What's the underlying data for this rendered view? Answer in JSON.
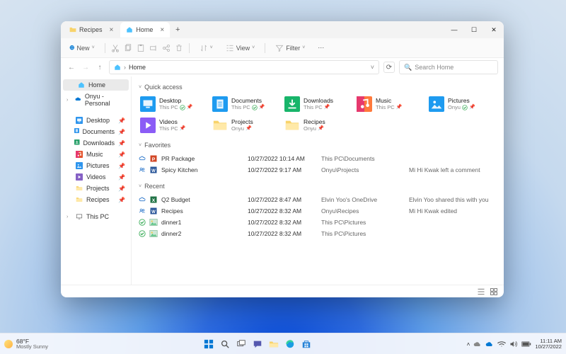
{
  "tabs": [
    {
      "label": "Recipes",
      "active": false,
      "icon_color": "#f8d36b"
    },
    {
      "label": "Home",
      "active": true,
      "icon_color": "#4cc2ff"
    }
  ],
  "toolbar": {
    "new": "New",
    "view": "View",
    "filter": "Filter"
  },
  "breadcrumb": {
    "location": "Home"
  },
  "search": {
    "placeholder": "Search Home"
  },
  "sidebar": {
    "top": [
      {
        "label": "Home",
        "icon": "home",
        "selected": true
      },
      {
        "label": "Onyu - Personal",
        "icon": "onedrive",
        "expandable": true
      }
    ],
    "pinned": [
      {
        "label": "Desktop",
        "icon": "desktop",
        "color": "#2f95ed"
      },
      {
        "label": "Documents",
        "icon": "documents",
        "color": "#2f95ed"
      },
      {
        "label": "Downloads",
        "icon": "downloads",
        "color": "#29a06a"
      },
      {
        "label": "Music",
        "icon": "music",
        "color": "#e5522c"
      },
      {
        "label": "Pictures",
        "icon": "pictures",
        "color": "#2f95ed"
      },
      {
        "label": "Videos",
        "icon": "videos",
        "color": "#8661c5"
      },
      {
        "label": "Projects",
        "icon": "folder",
        "color": "#f8d36b"
      },
      {
        "label": "Recipes",
        "icon": "folder",
        "color": "#f8d36b"
      }
    ],
    "thispc": {
      "label": "This PC"
    }
  },
  "sections": {
    "quick_access": {
      "title": "Quick access",
      "items": [
        {
          "name": "Desktop",
          "sub": "This PC",
          "color": "#1e9bf0",
          "icon": "desktop",
          "sync": "green"
        },
        {
          "name": "Documents",
          "sub": "This PC",
          "color": "#1e9bf0",
          "icon": "documents",
          "sync": "green"
        },
        {
          "name": "Downloads",
          "sub": "This PC",
          "color": "#18b56a",
          "icon": "downloads",
          "sync": ""
        },
        {
          "name": "Music",
          "sub": "This PC",
          "color": "#ff7a3c",
          "icon": "music",
          "sync": ""
        },
        {
          "name": "Pictures",
          "sub": "Onyu",
          "color": "#1e9bf0",
          "icon": "pictures",
          "sync": "green"
        },
        {
          "name": "Videos",
          "sub": "This PC",
          "color": "#8b5cf6",
          "icon": "videos",
          "sync": ""
        },
        {
          "name": "Projects",
          "sub": "Onyu",
          "color": "#f8d36b",
          "icon": "folder",
          "sync": ""
        },
        {
          "name": "Recipes",
          "sub": "Onyu",
          "color": "#f8d36b",
          "icon": "folder",
          "sync": ""
        }
      ]
    },
    "favorites": {
      "title": "Favorites",
      "items": [
        {
          "name": "PR Package",
          "date": "10/27/2022 10:14 AM",
          "path": "This PC\\Documents",
          "meta": "",
          "icon": "ppt",
          "icon_color": "#d24726",
          "sync": "cloud"
        },
        {
          "name": "Spicy Kitchen",
          "date": "10/27/2022 9:17 AM",
          "path": "Onyu\\Projects",
          "meta": "Mi Hi Kwak left a comment",
          "icon": "word",
          "icon_color": "#2b579a",
          "sync": "people"
        }
      ]
    },
    "recent": {
      "title": "Recent",
      "items": [
        {
          "name": "Q2 Budget",
          "date": "10/27/2022 8:47 AM",
          "path": "Elvin Yoo's OneDrive",
          "meta": "Elvin Yoo shared this with you",
          "icon": "xls",
          "icon_color": "#217346",
          "sync": "cloud"
        },
        {
          "name": "Recipes",
          "date": "10/27/2022 8:32 AM",
          "path": "Onyu\\Recipes",
          "meta": "Mi Hi Kwak edited",
          "icon": "word",
          "icon_color": "#2b579a",
          "sync": "people"
        },
        {
          "name": "dinner1",
          "date": "10/27/2022 8:32 AM",
          "path": "This PC\\Pictures",
          "meta": "",
          "icon": "img",
          "icon_color": "#60c689",
          "sync": "green"
        },
        {
          "name": "dinner2",
          "date": "10/27/2022 8:32 AM",
          "path": "This PC\\Pictures",
          "meta": "",
          "icon": "img",
          "icon_color": "#60c689",
          "sync": "green"
        }
      ]
    }
  },
  "taskbar": {
    "weather_temp": "68°F",
    "weather_desc": "Mostly Sunny",
    "time": "11:11 AM",
    "date": "10/27/2022"
  },
  "colors": {}
}
